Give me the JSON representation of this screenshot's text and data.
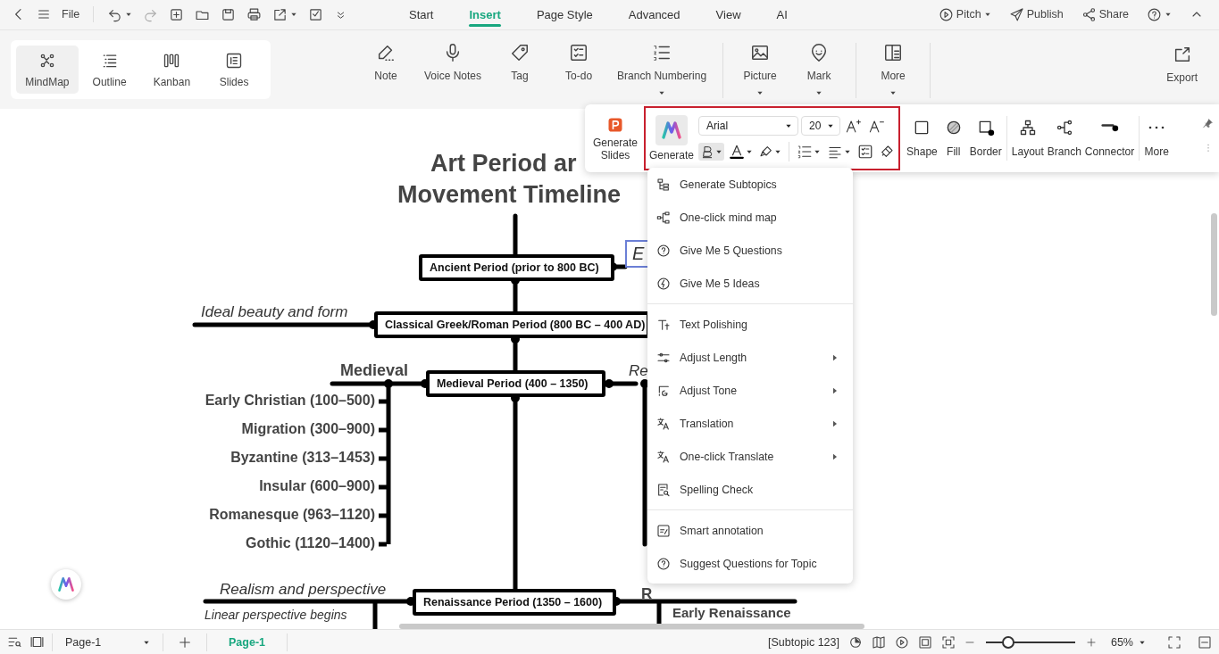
{
  "topbar": {
    "file_label": "File",
    "tabs": [
      {
        "label": "Start",
        "selected": false
      },
      {
        "label": "Insert",
        "selected": true
      },
      {
        "label": "Page Style",
        "selected": false
      },
      {
        "label": "Advanced",
        "selected": false
      },
      {
        "label": "View",
        "selected": false
      },
      {
        "label": "AI",
        "selected": false
      }
    ],
    "actions": [
      {
        "label": "Pitch",
        "dropdown": true
      },
      {
        "label": "Publish",
        "dropdown": false
      },
      {
        "label": "Share",
        "dropdown": false
      }
    ]
  },
  "ribbon": {
    "view_modes": [
      {
        "label": "MindMap",
        "selected": true
      },
      {
        "label": "Outline",
        "selected": false
      },
      {
        "label": "Kanban",
        "selected": false
      },
      {
        "label": "Slides",
        "selected": false
      }
    ],
    "tool_groups": [
      [
        {
          "label": "Note",
          "dropdown": false
        },
        {
          "label": "Voice Notes",
          "dropdown": false
        },
        {
          "label": "Tag",
          "dropdown": false
        },
        {
          "label": "To-do",
          "dropdown": false
        },
        {
          "label": "Branch Numbering",
          "dropdown": true
        }
      ],
      [
        {
          "label": "Picture",
          "dropdown": true
        },
        {
          "label": "Mark",
          "dropdown": true
        }
      ],
      [
        {
          "label": "More",
          "dropdown": true
        }
      ]
    ],
    "export_label": "Export"
  },
  "mind_map": {
    "title_lines": [
      "Art Period ar",
      "Movement Timeline"
    ],
    "main_topics": [
      "Ancient Period (prior to 800 BC)",
      "Classical Greek/Roman Period (800 BC – 400 AD)",
      "Medieval Period (400 – 1350)",
      "Renaissance Period (1350 – 1600)"
    ],
    "selected_topic": {
      "text": "E",
      "selected": true
    },
    "labels": [
      {
        "text": "Ideal beauty and form",
        "kind": "italic"
      },
      {
        "text": "Medieval",
        "kind": "bold"
      },
      {
        "text": "Re",
        "kind": "italic"
      },
      {
        "text": "Realism and perspective",
        "kind": "italic"
      },
      {
        "text": "R",
        "kind": "bold"
      },
      {
        "text": "Linear perspective begins",
        "kind": "italic"
      },
      {
        "text": "Early Renaissance",
        "kind": "bold"
      }
    ],
    "subtopics": [
      "Early Christian (100–500)",
      "Migration (300–900)",
      "Byzantine (313–1453)",
      "Insular (600–900)",
      "Romanesque (963–1120)",
      "Gothic (1120–1400)"
    ]
  },
  "float_toolbar": {
    "generate_slides": "Generate Slides",
    "generate": {
      "label": "Generate",
      "selected": true
    },
    "font": "Arial",
    "size": "20",
    "bold_selected": true,
    "tool_groups": [
      [
        {
          "label": "Shape"
        },
        {
          "label": "Fill"
        },
        {
          "label": "Border"
        }
      ],
      [
        {
          "label": "Layout"
        },
        {
          "label": "Branch"
        },
        {
          "label": "Connector"
        }
      ],
      [
        {
          "label": "More"
        }
      ]
    ]
  },
  "ai_menu": {
    "groups": [
      [
        {
          "label": "Generate Subtopics",
          "submenu": false
        },
        {
          "label": "One-click mind map",
          "submenu": false
        },
        {
          "label": "Give Me 5 Questions",
          "submenu": false
        },
        {
          "label": "Give Me 5 Ideas",
          "submenu": false
        }
      ],
      [
        {
          "label": "Text Polishing",
          "submenu": false
        },
        {
          "label": "Adjust Length",
          "submenu": true
        },
        {
          "label": "Adjust Tone",
          "submenu": true
        },
        {
          "label": "Translation",
          "submenu": true
        },
        {
          "label": "One-click Translate",
          "submenu": true
        },
        {
          "label": "Spelling Check",
          "submenu": false
        }
      ],
      [
        {
          "label": "Smart annotation",
          "submenu": false
        },
        {
          "label": "Suggest Questions for Topic",
          "submenu": false
        }
      ]
    ]
  },
  "status_bar": {
    "page_select": "Page-1",
    "page_tabs": [
      {
        "label": "Page-1",
        "selected": true
      }
    ],
    "selection": "[Subtopic 123]",
    "zoom": {
      "level": 0.2,
      "reading": "65%"
    }
  }
}
